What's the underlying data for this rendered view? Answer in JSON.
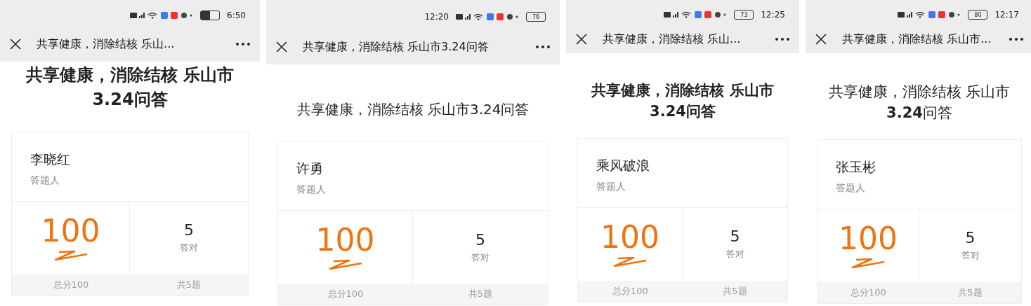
{
  "screens": [
    {
      "status_bar": [
        {
          "kind": "icons"
        },
        {
          "kind": "battery"
        },
        {
          "kind": "time",
          "text": "6:50"
        }
      ],
      "nav_title": "共享健康，消除结核 乐山...",
      "title": "共享健康，消除结核 乐山市3.24问答",
      "title_bold": true,
      "card": {
        "name": "李晓红",
        "role": "答题人",
        "score": "100",
        "correct": "5",
        "correct_label": "答对",
        "total_score": "总分100",
        "total_questions": "共5题"
      }
    },
    {
      "status_bar": [
        {
          "kind": "time",
          "text": "12:20"
        },
        {
          "kind": "icons"
        },
        {
          "kind": "battery",
          "text": "76"
        }
      ],
      "nav_title": "共享健康，消除结核 乐山市3.24问答",
      "title": "共享健康，消除结核 乐山市3.24问答",
      "title_bold": false,
      "card": {
        "name": "许勇",
        "role": "答题人",
        "score": "100",
        "correct": "5",
        "correct_label": "答对",
        "total_score": "总分100",
        "total_questions": "共5题"
      }
    },
    {
      "status_bar": [
        {
          "kind": "icons"
        },
        {
          "kind": "battery",
          "text": "73"
        },
        {
          "kind": "time",
          "text": "12:25"
        }
      ],
      "nav_title": "共享健康，消除结核 乐山...",
      "title": "共享健康，消除结核 乐山市3.24问答",
      "title_bold": true,
      "card": {
        "name": "乘风破浪",
        "role": "答题人",
        "score": "100",
        "correct": "5",
        "correct_label": "答对",
        "total_score": "总分100",
        "total_questions": "共5题"
      }
    },
    {
      "status_bar": [
        {
          "kind": "icons"
        },
        {
          "kind": "battery",
          "text": "80"
        },
        {
          "kind": "time",
          "text": "12:17"
        }
      ],
      "nav_title": "共享健康，消除结核 乐山市...",
      "title": "共享健康，消除结核 乐山市**3.24**问答",
      "title_bold": false,
      "card": {
        "name": "张玉彬",
        "role": "答题人",
        "score": "100",
        "correct": "5",
        "correct_label": "答对",
        "total_score": "总分100",
        "total_questions": "共5题"
      }
    }
  ]
}
